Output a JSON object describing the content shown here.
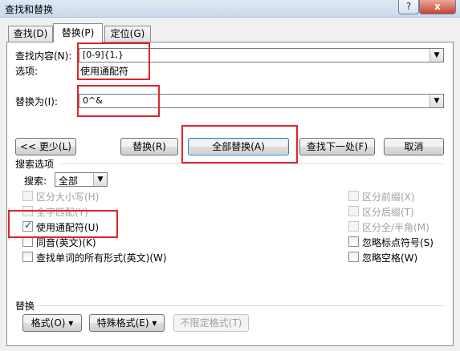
{
  "window": {
    "title": "查找和替换",
    "help_label": "?",
    "close_label": "x"
  },
  "tabs": [
    {
      "label": "查找(D)",
      "active": false
    },
    {
      "label": "替换(P)",
      "active": true
    },
    {
      "label": "定位(G)",
      "active": false
    }
  ],
  "find": {
    "label": "查找内容(N):",
    "value": "[0-9]{1,}",
    "options_label": "选项:",
    "options_value": "使用通配符"
  },
  "replace": {
    "label": "替换为(I):",
    "value": "0^&"
  },
  "buttons": {
    "less": "<< 更少(L)",
    "replace": "替换(R)",
    "replace_all": "全部替换(A)",
    "find_next": "查找下一处(F)",
    "cancel": "取消"
  },
  "search_options": {
    "title": "搜索选项",
    "search_label": "搜索:",
    "search_value": "全部",
    "left": [
      {
        "label": "区分大小写(H)",
        "checked": false,
        "disabled": true
      },
      {
        "label": "全字匹配(Y)",
        "checked": false,
        "disabled": true
      },
      {
        "label": "使用通配符(U)",
        "checked": true,
        "disabled": false
      },
      {
        "label": "同音(英文)(K)",
        "checked": false,
        "disabled": false
      },
      {
        "label": "查找单词的所有形式(英文)(W)",
        "checked": false,
        "disabled": false
      }
    ],
    "right": [
      {
        "label": "区分前缀(X)",
        "checked": false,
        "disabled": true
      },
      {
        "label": "区分后缀(T)",
        "checked": false,
        "disabled": true
      },
      {
        "label": "区分全/半角(M)",
        "checked": false,
        "disabled": true
      },
      {
        "label": "忽略标点符号(S)",
        "checked": false,
        "disabled": false
      },
      {
        "label": "忽略空格(W)",
        "checked": false,
        "disabled": false
      }
    ]
  },
  "replace_section": {
    "title": "替换",
    "format_label": "格式(O) ▾",
    "special_label": "特殊格式(E) ▾",
    "no_format_label": "不限定格式(T)"
  },
  "colors": {
    "highlight_border": "#e2232a",
    "check_mark": "#1a3f8a"
  }
}
